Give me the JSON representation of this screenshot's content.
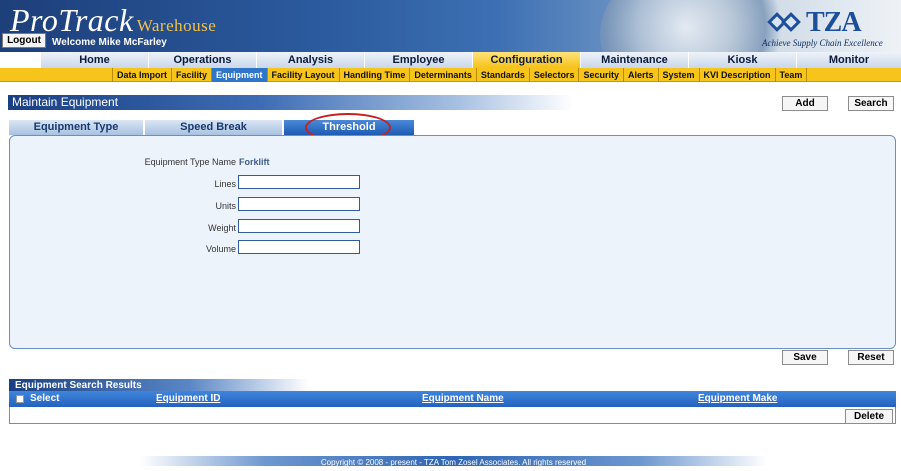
{
  "header": {
    "brand_main": "ProTrack",
    "brand_sub": "Warehouse",
    "logout_label": "Logout",
    "welcome": "Welcome Mike McFarley",
    "logo_text": "TZA",
    "logo_tagline": "Achieve Supply Chain Excellence"
  },
  "main_nav": {
    "tabs": [
      {
        "label": "Home"
      },
      {
        "label": "Operations"
      },
      {
        "label": "Analysis"
      },
      {
        "label": "Employee"
      },
      {
        "label": "Configuration",
        "active": true
      },
      {
        "label": "Maintenance"
      },
      {
        "label": "Kiosk"
      },
      {
        "label": "Monitor"
      }
    ]
  },
  "sub_nav": {
    "items": [
      {
        "label": "Data Import"
      },
      {
        "label": "Facility"
      },
      {
        "label": "Equipment",
        "active": true
      },
      {
        "label": "Facility Layout"
      },
      {
        "label": "Handling Time"
      },
      {
        "label": "Determinants"
      },
      {
        "label": "Standards"
      },
      {
        "label": "Selectors"
      },
      {
        "label": "Security"
      },
      {
        "label": "Alerts"
      },
      {
        "label": "System"
      },
      {
        "label": "KVI Description"
      },
      {
        "label": "Team"
      }
    ]
  },
  "page": {
    "title": "Maintain Equipment",
    "add_label": "Add",
    "search_label": "Search"
  },
  "section_tabs": [
    {
      "label": "Equipment Type"
    },
    {
      "label": "Speed Break"
    },
    {
      "label": "Threshold",
      "active": true
    }
  ],
  "form": {
    "equipment_type_label": "Equipment Type Name",
    "equipment_type_value": "Forklift",
    "fields": [
      {
        "label": "Lines",
        "value": ""
      },
      {
        "label": "Units",
        "value": ""
      },
      {
        "label": "Weight",
        "value": ""
      },
      {
        "label": "Volume",
        "value": ""
      }
    ],
    "save_label": "Save",
    "reset_label": "Reset"
  },
  "results": {
    "title": "Equipment Search Results",
    "columns": [
      "Select",
      "Equipment ID",
      "Equipment Name",
      "Equipment Make"
    ],
    "delete_label": "Delete"
  },
  "footer": {
    "copyright": "Copyright © 2008 - present - TZA Tom Zosel Associates. All rights reserved"
  },
  "colors": {
    "header_blue": "#1d3f7a",
    "nav_yellow": "#f6c41b",
    "active_blue": "#2f75c8",
    "highlight_ring": "#c62020"
  }
}
